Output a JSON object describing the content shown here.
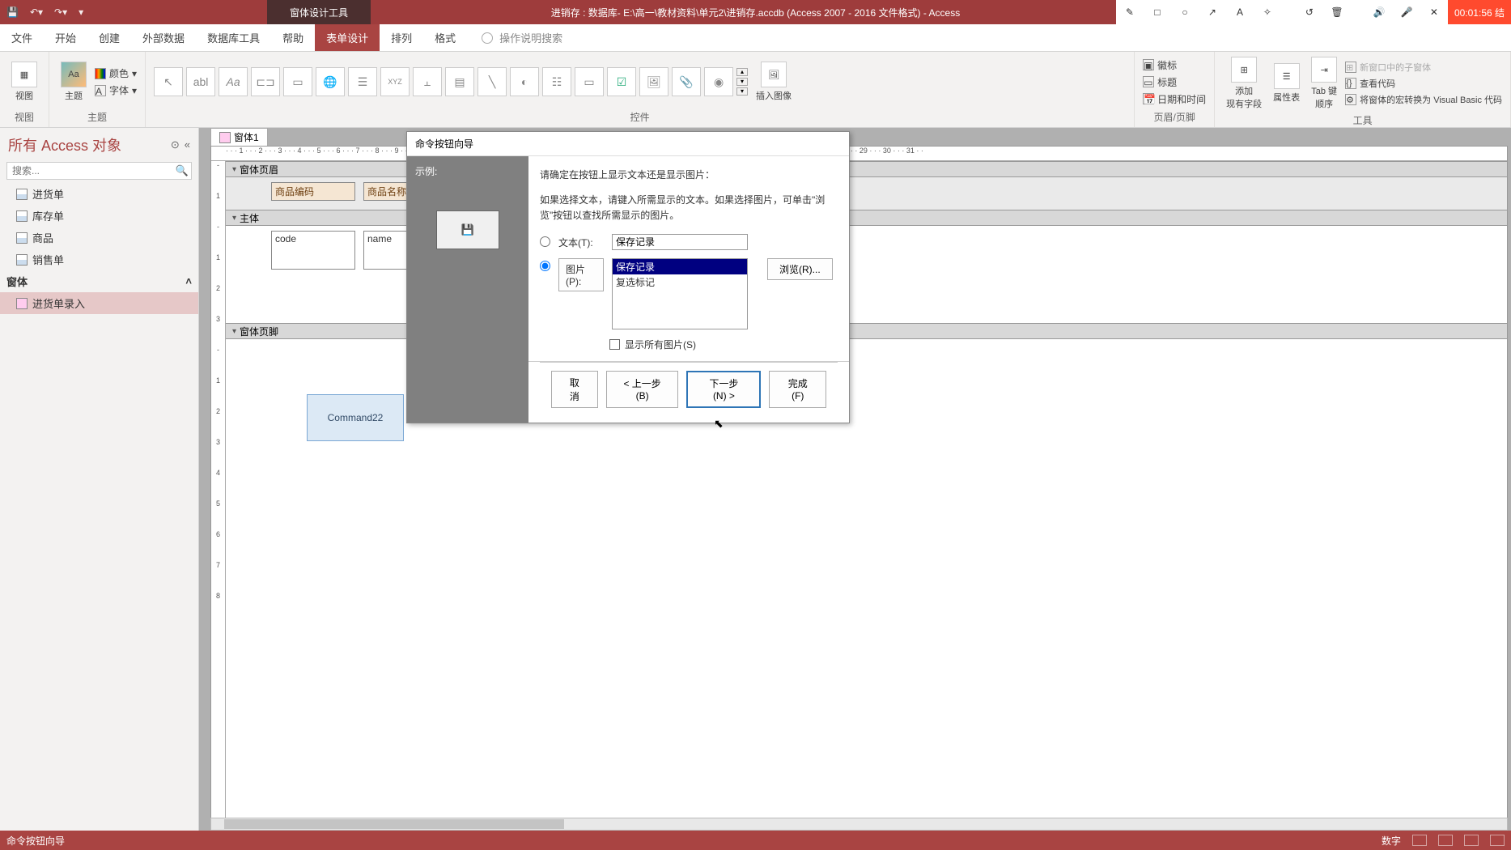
{
  "titlebar": {
    "tool_context": "窗体设计工具",
    "document": "进销存 : 数据库- E:\\高一\\教材资料\\单元2\\进销存.accdb (Access 2007 - 2016 文件格式)  -  Access",
    "timer": "00:01:56 结"
  },
  "tabs": {
    "file": "文件",
    "home": "开始",
    "create": "创建",
    "external": "外部数据",
    "dbtools": "数据库工具",
    "help": "帮助",
    "formdesign": "表单设计",
    "arrange": "排列",
    "format": "格式",
    "tellme": "操作说明搜索"
  },
  "ribbon": {
    "views_group": "视图",
    "views_btn": "视图",
    "theme_group": "主题",
    "theme_btn": "主题",
    "colors": "颜色",
    "fonts": "字体",
    "controls_group": "控件",
    "insert_image": "插入图像",
    "headerfooter_group": "页眉/页脚",
    "logo": "徽标",
    "title": "标题",
    "datetime": "日期和时间",
    "add_fields": "添加\n现有字段",
    "prop_sheet": "属性表",
    "tab_order": "Tab 键\n顺序",
    "subform_new": "新窗口中的子窗体",
    "view_code": "查看代码",
    "convert_macros": "将窗体的宏转换为 Visual Basic 代码",
    "tools_group": "工具"
  },
  "nav": {
    "header": "所有 Access 对象",
    "search_placeholder": "搜索...",
    "items": {
      "table1": "进货单",
      "table2": "库存单",
      "table3": "商品",
      "table4": "销售单",
      "group": "窗体",
      "form1": "进货单录入"
    }
  },
  "form": {
    "tab_name": "窗体1",
    "ruler": "· · · 1 · · · 2 · · · 3 · · · 4 · · · 5 · · · 6 · · · 7 · · · 8 · · · 9 · · · 10 · · · 11 · · · 12 · · · 13 · · · 14 · · · 15 · · · 16 · · · 17 · · · 18 · · · 19 · · · 20 · · · 21 · · · 22 · · · 23 · · · 24 · · · 25 · · · 26 · · · 27 · · · 28 · · · 29 · · · 30 · · · 31 · ·",
    "section_header": "窗体页眉",
    "section_detail": "主体",
    "section_footer": "窗体页脚",
    "lbl_code": "商品编码",
    "lbl_name": "商品名称",
    "fld_code": "code",
    "fld_name": "name",
    "cmd22": "Command22"
  },
  "wizard": {
    "title": "命令按钮向导",
    "preview_label": "示例:",
    "line1": "请确定在按钮上显示文本还是显示图片：",
    "line2": "如果选择文本，请键入所需显示的文本。如果选择图片，可单击\"浏览\"按钮以查找所需显示的图片。",
    "opt_text": "文本(T):",
    "text_value": "保存记录",
    "opt_pic": "图片(P):",
    "pic_item1": "保存记录",
    "pic_item2": "复选标记",
    "browse": "浏览(R)...",
    "show_all": "显示所有图片(S)",
    "btn_cancel": "取消",
    "btn_back": "< 上一步(B)",
    "btn_next": "下一步(N) >",
    "btn_finish": "完成(F)"
  },
  "status": {
    "left": "命令按钮向导",
    "numlock": "数字"
  }
}
